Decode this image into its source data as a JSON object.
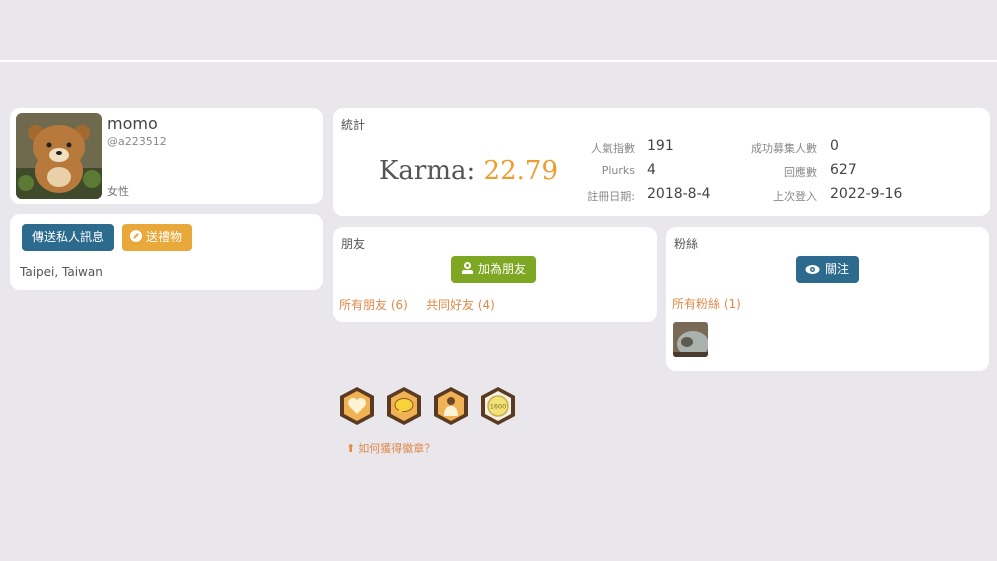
{
  "profile": {
    "display_name": "momo",
    "nick": "@a223512",
    "gender": "女性",
    "location": "Taipei, Taiwan"
  },
  "actions": {
    "message_label": "傳送私人訊息",
    "gift_label": "送禮物"
  },
  "stats": {
    "title": "統計",
    "karma_label": "Karma:",
    "karma_value": "22.79",
    "popularity_label": "人氣指數",
    "popularity_value": "191",
    "plurks_label": "Plurks",
    "plurks_value": "4",
    "joined_label": "註冊日期:",
    "joined_value": "2018-8-4",
    "recruited_label": "成功募集人數",
    "recruited_value": "0",
    "responses_label": "回應數",
    "responses_value": "627",
    "last_login_label": "上次登入",
    "last_login_value": "2022-9-16"
  },
  "friends": {
    "title": "朋友",
    "add_label": "加為朋友",
    "all_friends": "所有朋友 (6)",
    "mutual_friends": "共同好友 (4)"
  },
  "fans": {
    "title": "粉絲",
    "follow_label": "關注",
    "all_fans": "所有粉絲 (1)"
  },
  "badges": {
    "items": [
      "heart-badge-icon",
      "chat-badge-icon",
      "person-badge-icon",
      "1600-badge-icon"
    ],
    "badge_1600_text": "1600",
    "help_label": "如何獲得徽章？"
  },
  "colors": {
    "background": "#e9e6ec",
    "blue_button": "#2d6b8e",
    "orange_button": "#e8a83a",
    "green_button": "#7ea724",
    "karma": "#f19b2c",
    "link": "#e18a4a"
  }
}
